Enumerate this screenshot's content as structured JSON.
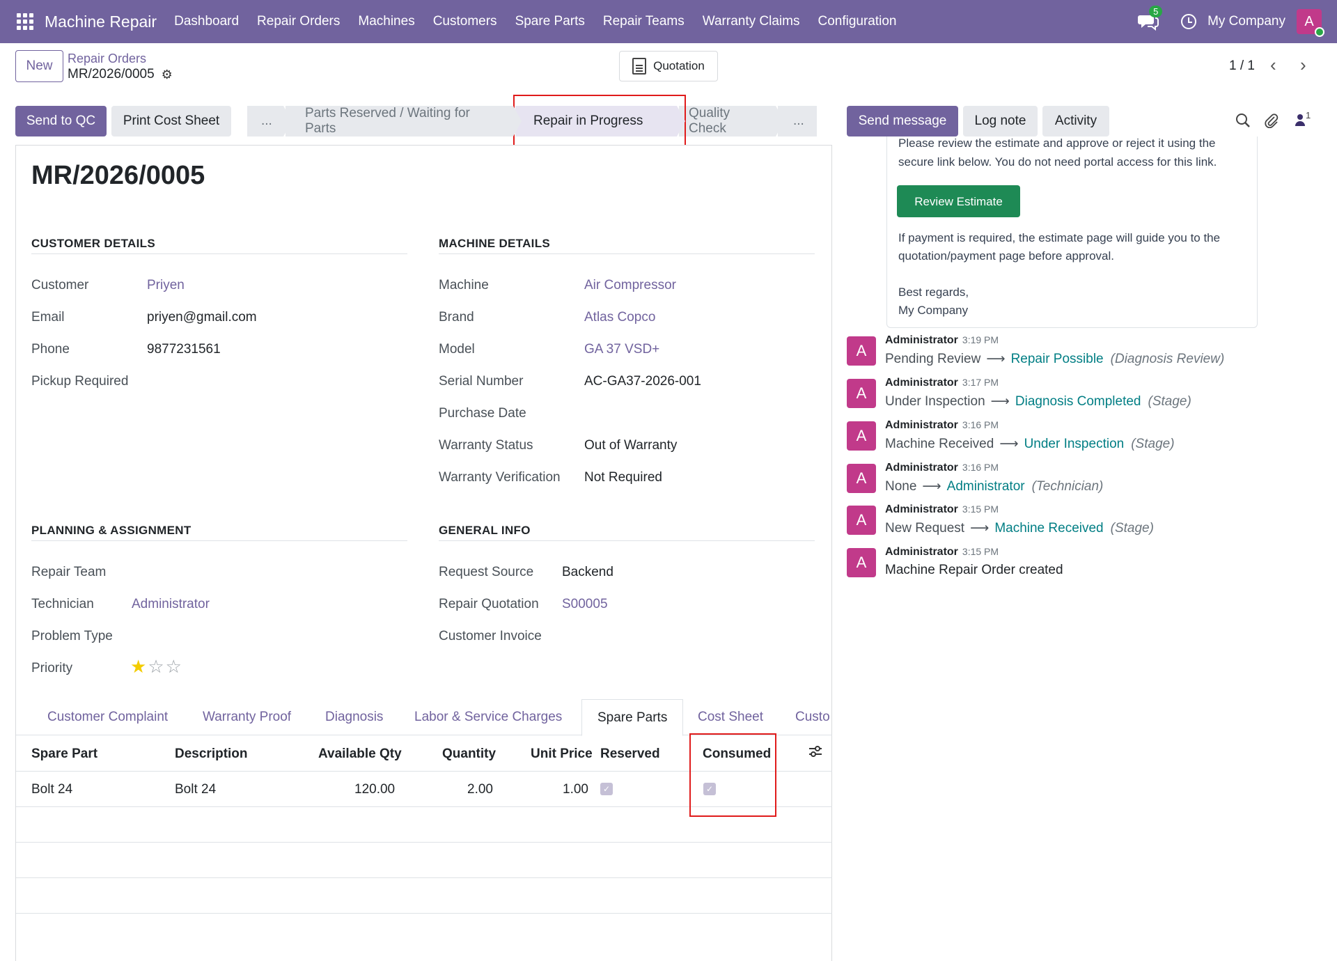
{
  "topbar": {
    "app_name": "Machine Repair",
    "menu": [
      "Dashboard",
      "Repair Orders",
      "Machines",
      "Customers",
      "Spare Parts",
      "Repair Teams",
      "Warranty Claims",
      "Configuration"
    ],
    "messages_badge": "5",
    "company": "My Company",
    "avatar_letter": "A"
  },
  "control": {
    "new_label": "New",
    "breadcrumb_parent": "Repair Orders",
    "breadcrumb_current": "MR/2026/0005",
    "quotation_label": "Quotation",
    "pager": "1 / 1"
  },
  "actions": {
    "send_to_qc": "Send to QC",
    "print_cost_sheet": "Print Cost Sheet"
  },
  "statusbar": {
    "stages": [
      "...",
      "Parts Reserved / Waiting for Parts",
      "Repair in Progress",
      "Quality Check",
      "..."
    ],
    "active_stage": "Repair in Progress"
  },
  "record": {
    "title": "MR/2026/0005",
    "customer_details": {
      "heading": "CUSTOMER DETAILS",
      "customer_label": "Customer",
      "customer": "Priyen",
      "email_label": "Email",
      "email": "priyen@gmail.com",
      "phone_label": "Phone",
      "phone": "9877231561",
      "pickup_label": "Pickup Required"
    },
    "machine_details": {
      "heading": "MACHINE DETAILS",
      "machine_label": "Machine",
      "machine": "Air Compressor",
      "brand_label": "Brand",
      "brand": "Atlas Copco",
      "model_label": "Model",
      "model": "GA 37 VSD+",
      "serial_label": "Serial Number",
      "serial": "AC-GA37-2026-001",
      "purchase_label": "Purchase Date",
      "warranty_status_label": "Warranty Status",
      "warranty_status": "Out of Warranty",
      "warranty_verif_label": "Warranty Verification",
      "warranty_verif": "Not Required"
    },
    "planning": {
      "heading": "PLANNING & ASSIGNMENT",
      "team_label": "Repair Team",
      "tech_label": "Technician",
      "technician": "Administrator",
      "problem_label": "Problem Type",
      "priority_label": "Priority",
      "priority_stars": 1,
      "priority_max": 3
    },
    "general": {
      "heading": "GENERAL INFO",
      "source_label": "Request Source",
      "source": "Backend",
      "quotation_label": "Repair Quotation",
      "quotation": "S00005",
      "invoice_label": "Customer Invoice"
    }
  },
  "tabs": [
    "Customer Complaint",
    "Warranty Proof",
    "Diagnosis",
    "Labor & Service Charges",
    "Spare Parts",
    "Cost Sheet",
    "Custo"
  ],
  "active_tab": "Spare Parts",
  "spare_parts": {
    "columns": [
      "Spare Part",
      "Description",
      "Available Qty",
      "Quantity",
      "Unit Price",
      "Reserved",
      "Consumed"
    ],
    "rows": [
      {
        "part": "Bolt 24",
        "description": "Bolt 24",
        "available": "120.00",
        "quantity": "2.00",
        "unit_price": "1.00",
        "reserved": true,
        "consumed": true
      }
    ]
  },
  "chatter": {
    "send_message": "Send message",
    "log_note": "Log note",
    "activity": "Activity",
    "followers": "1",
    "mail": {
      "line1": "Please review the estimate and approve or reject it using the",
      "line2": "secure link below. You do not need portal access for this link.",
      "review_button": "Review Estimate",
      "line3": "If payment is required, the estimate page will guide you to the",
      "line4": "quotation/payment page before approval.",
      "line5": "Best regards,",
      "line6": "My Company"
    },
    "messages": [
      {
        "author": "Administrator",
        "time": "3:19 PM",
        "old": "Pending Review",
        "new": "Repair Possible",
        "field": "(Diagnosis Review)"
      },
      {
        "author": "Administrator",
        "time": "3:17 PM",
        "old": "Under Inspection",
        "new": "Diagnosis Completed",
        "field": "(Stage)"
      },
      {
        "author": "Administrator",
        "time": "3:16 PM",
        "old": "Machine Received",
        "new": "Under Inspection",
        "field": "(Stage)"
      },
      {
        "author": "Administrator",
        "time": "3:16 PM",
        "old": "None",
        "new": "Administrator",
        "field": "(Technician)"
      },
      {
        "author": "Administrator",
        "time": "3:15 PM",
        "old": "New Request",
        "new": "Machine Received",
        "field": "(Stage)"
      },
      {
        "author": "Administrator",
        "time": "3:15 PM",
        "text": "Machine Repair Order created"
      }
    ]
  }
}
